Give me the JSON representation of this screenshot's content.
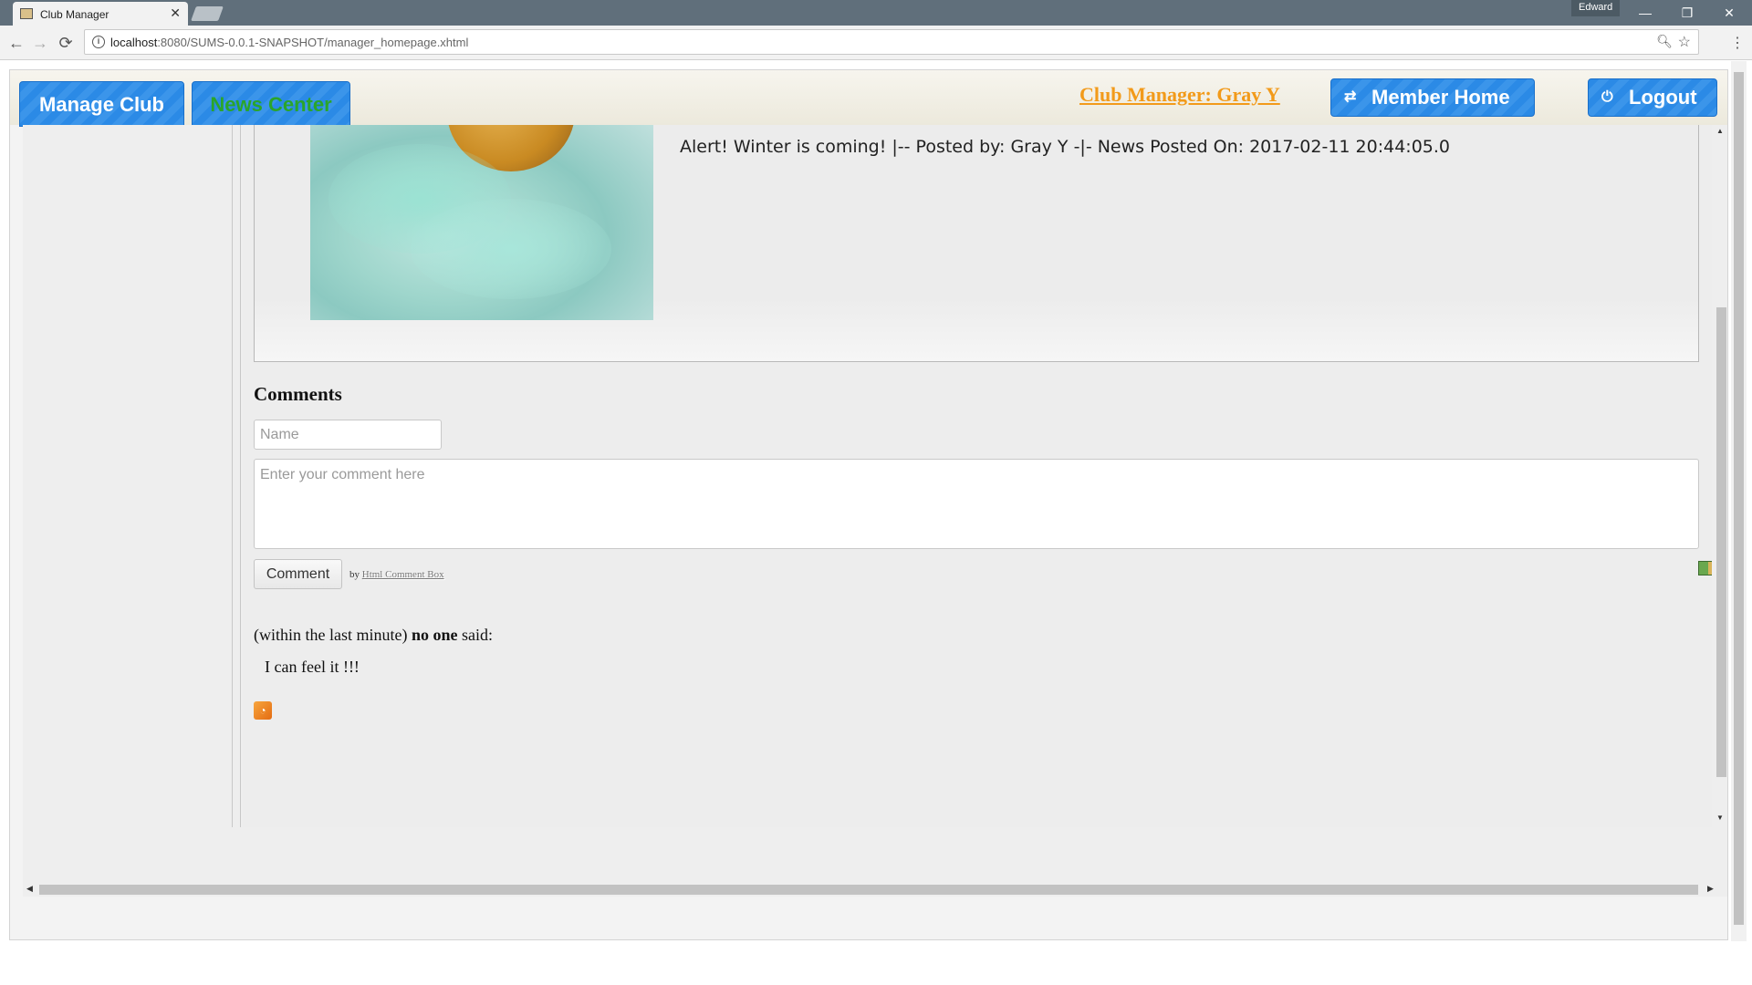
{
  "browser": {
    "tab_title": "Club Manager",
    "tab_close": "✕",
    "profile": "Edward",
    "url_host": "localhost",
    "url_rest": ":8080/SUMS-0.0.1-SNAPSHOT/manager_homepage.xhtml",
    "back_icon": "←",
    "forward_icon": "→",
    "reload_icon": "⟳",
    "minimize": "—",
    "restore": "❐",
    "close": "✕"
  },
  "header": {
    "tabs": [
      {
        "label": "Manage Club"
      },
      {
        "label": "News Center"
      }
    ],
    "user_link": "Club Manager: Gray Y",
    "member_home_label": "Member Home",
    "logout_label": "Logout",
    "accent_color": "#2b8ae6",
    "user_link_color": "#f29a1a"
  },
  "news": {
    "text": "Alert! Winter is coming! |-- Posted by: Gray Y -|- News Posted On: 2017-02-11 20:44:05.0"
  },
  "comments": {
    "title": "Comments",
    "name_placeholder": "Name",
    "comment_placeholder": "Enter your comment here",
    "button_label": "Comment",
    "by_prefix": "by",
    "by_link": "Html Comment Box",
    "entries": [
      {
        "time": "(within the last minute)",
        "author": "no one",
        "said": "said:",
        "body": "I can feel it !!!"
      }
    ]
  }
}
